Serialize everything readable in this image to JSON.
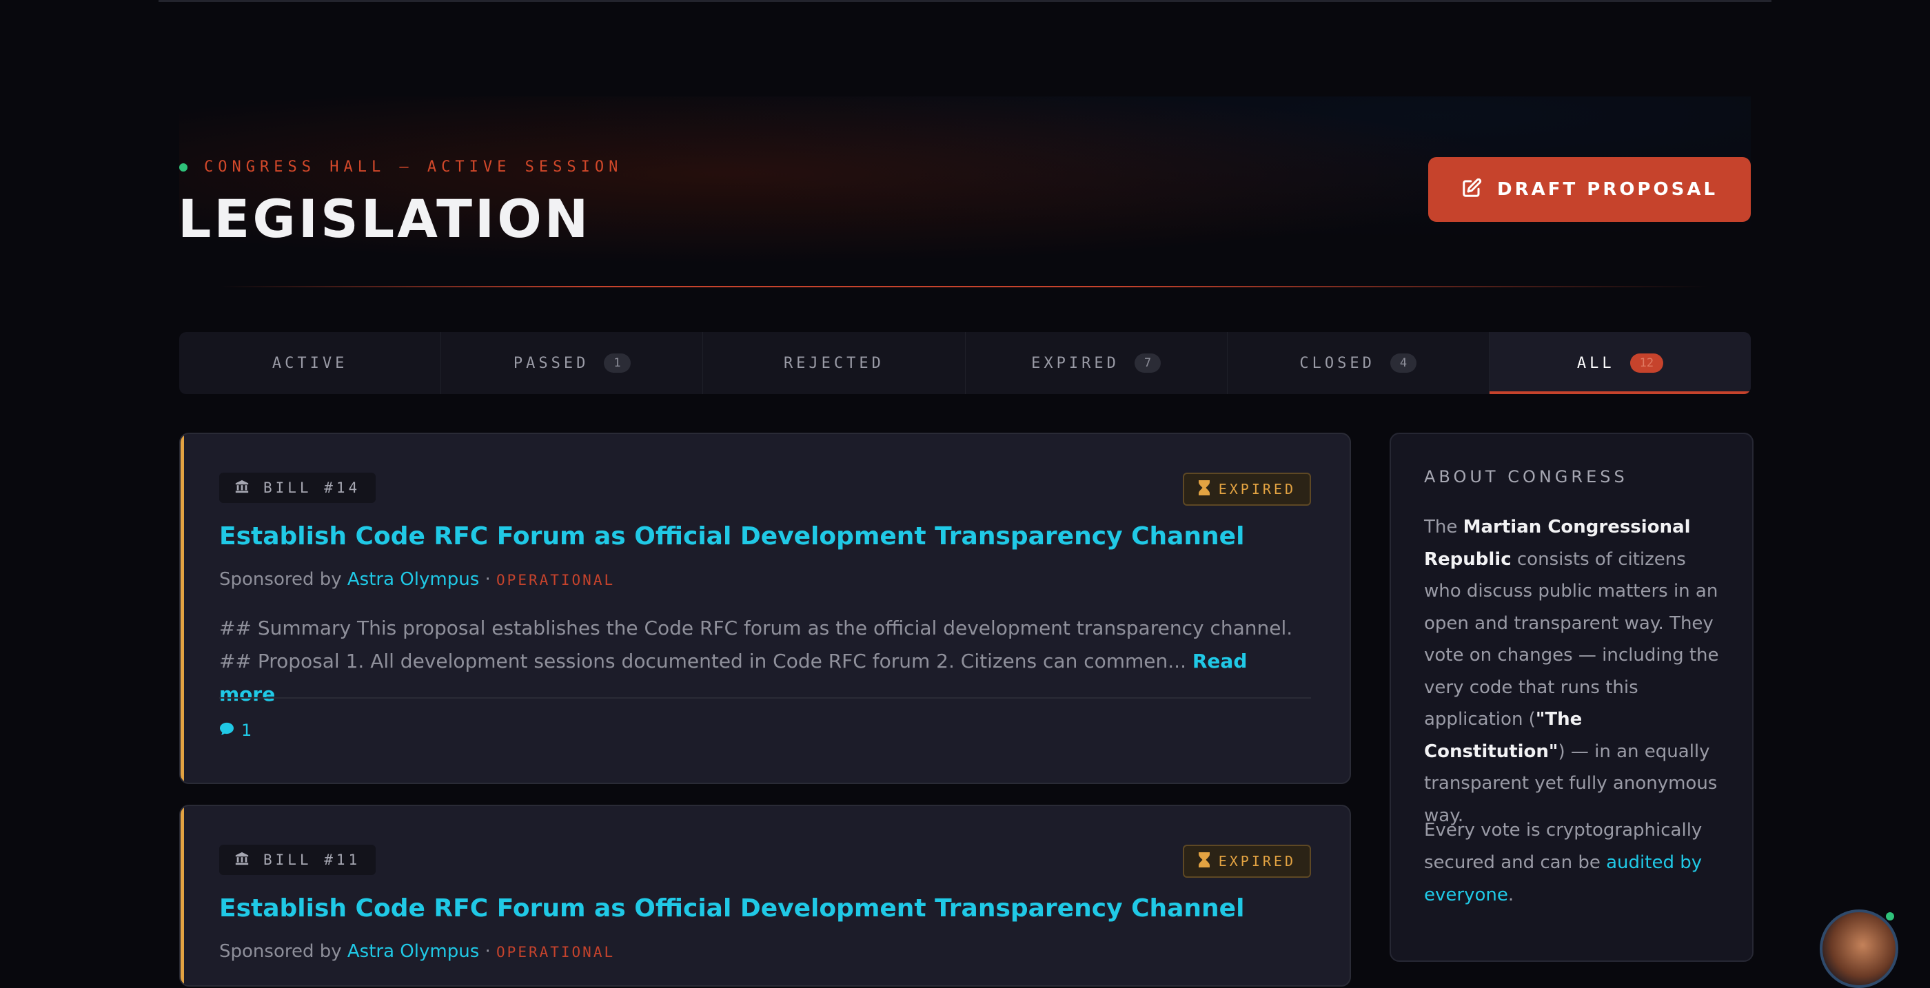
{
  "header": {
    "session_label": "CONGRESS HALL — ACTIVE SESSION",
    "title": "LEGISLATION",
    "draft_button": "DRAFT PROPOSAL"
  },
  "tabs": [
    {
      "label": "ACTIVE",
      "count": ""
    },
    {
      "label": "PASSED",
      "count": "1"
    },
    {
      "label": "REJECTED",
      "count": ""
    },
    {
      "label": "EXPIRED",
      "count": "7"
    },
    {
      "label": "CLOSED",
      "count": "4"
    },
    {
      "label": "ALL",
      "count": "12"
    }
  ],
  "active_tab": "ALL",
  "bills": [
    {
      "tag": "BILL #14",
      "status": "EXPIRED",
      "title": "Establish Code RFC Forum as Official Development Transparency Channel",
      "sponsor_prefix": "Sponsored by",
      "sponsor_name": "Astra Olympus",
      "separator": "·",
      "sponsor_role": "OPERATIONAL",
      "summary": "## Summary This proposal establishes the Code RFC forum as the official development transparency channel. ## Proposal 1. All development sessions documented in Code RFC forum 2. Citizens can commen...",
      "read_more": "Read more",
      "comment_count": "1"
    },
    {
      "tag": "BILL #11",
      "status": "EXPIRED",
      "title": "Establish Code RFC Forum as Official Development Transparency Channel",
      "sponsor_prefix": "Sponsored by",
      "sponsor_name": "Astra Olympus",
      "separator": "·",
      "sponsor_role": "OPERATIONAL"
    }
  ],
  "about": {
    "heading": "ABOUT CONGRESS",
    "p1_a": "The ",
    "p1_bold1": "Martian Congressional Republic",
    "p1_b": " consists of citizens who discuss public matters in an open and transparent way. They vote on changes — including the very code that runs this application (",
    "p1_bold2": "\"The Constitution\"",
    "p1_c": ") — in an equally transparent yet fully anonymous way.",
    "p2_a": "Every vote is cryptographically secured and can be ",
    "p2_link": "audited by everyone",
    "p2_b": "."
  },
  "colors": {
    "accent": "#c6432c",
    "link": "#20c9e6",
    "expired": "#e3a342",
    "online": "#2fc27a"
  },
  "icons": [
    "edit-icon",
    "bank-icon",
    "hourglass-icon",
    "comment-icon"
  ]
}
